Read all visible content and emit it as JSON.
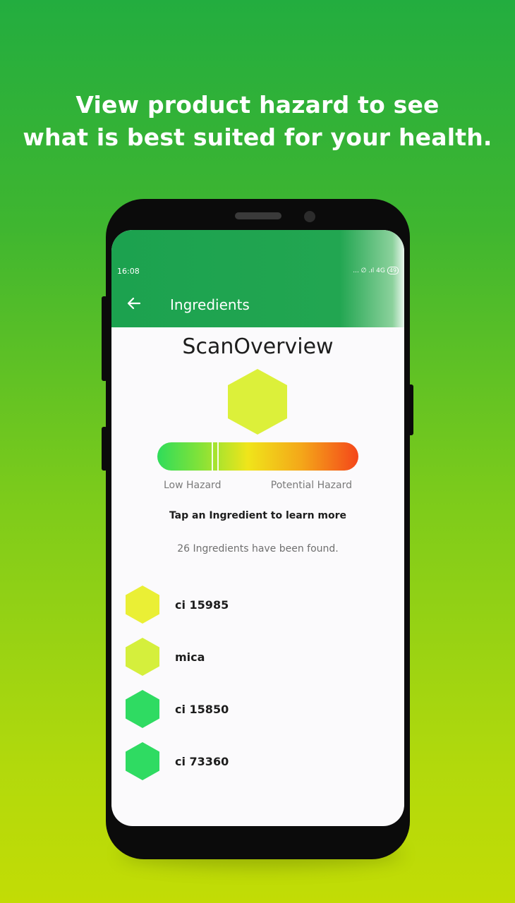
{
  "headline": {
    "line1": "View product hazard to see",
    "line2": "what is best suited for your health."
  },
  "status_bar": {
    "time": "16:08",
    "icons_text": "... ∅ .ıl 4G",
    "battery": "49"
  },
  "app_bar": {
    "back_icon": "arrow-left-icon",
    "title": "Ingredients"
  },
  "scan": {
    "title_bold": "Scan",
    "title_light": "Overview",
    "overall_hex_color": "#dcf03a",
    "hazard_level": 0.27,
    "low_label": "Low Hazard",
    "high_label": "Potential Hazard",
    "tap_text": "Tap an Ingredient to learn more",
    "found_text": "26 Ingredients have been found."
  },
  "ingredients": [
    {
      "name": "ci 15985",
      "color": "#eaef35"
    },
    {
      "name": "mica",
      "color": "#d5ef3c"
    },
    {
      "name": "ci 15850",
      "color": "#2fdb62"
    },
    {
      "name": "ci 73360",
      "color": "#2fdb62"
    }
  ],
  "colors": {
    "accent": "#1ca24f",
    "background_top": "#23ad3f",
    "background_bottom": "#c2dc05"
  }
}
